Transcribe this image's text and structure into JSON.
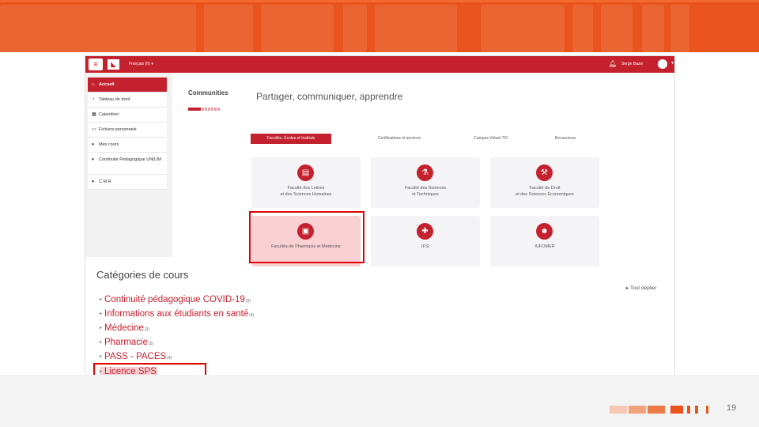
{
  "slide": {
    "page_number": "19",
    "theme_color": "#e8541b"
  },
  "app": {
    "menu_icon": "hamburger-icon",
    "logo_icon": "university-logo",
    "language": "Français (fr) ▾",
    "user_name": "Serge Bazin",
    "accent_color": "#c4212e"
  },
  "sidebar": {
    "items": [
      {
        "label": "Accueil",
        "icon": "home-icon"
      },
      {
        "label": "Tableau de bord",
        "icon": "dashboard-icon"
      },
      {
        "label": "Calendrier",
        "icon": "calendar-icon"
      },
      {
        "label": "Fichiers personnels",
        "icon": "file-icon"
      },
      {
        "label": "Mes cours",
        "icon": "graduation-cap-icon"
      },
      {
        "label": "Continuité Pédagogique UNILIM",
        "icon": "graduation-cap-icon"
      },
      {
        "label": "C.M.R",
        "icon": "graduation-cap-icon"
      }
    ]
  },
  "main": {
    "communities_label": "Communities",
    "title": "Partager, communiquer, apprendre",
    "tabs": [
      {
        "label": "Facultés, Écoles et Instituts"
      },
      {
        "label": "Certifications et services"
      },
      {
        "label": "Campus Virtuel TIC"
      },
      {
        "label": "Ressources"
      }
    ],
    "cards": [
      {
        "line1": "Faculté des Lettres",
        "line2": "et des Sciences Humaines",
        "icon": "book-icon"
      },
      {
        "line1": "Faculté des Sciences",
        "line2": "et Techniques",
        "icon": "flask-icon"
      },
      {
        "line1": "Faculté de Droit",
        "line2": "et des Sciences Économiques",
        "icon": "gavel-icon"
      },
      {
        "line1": "Facultés de Pharmacie et Médecine",
        "line2": "",
        "icon": "hospital-icon"
      },
      {
        "line1": "IFSI",
        "line2": "",
        "icon": "medical-kit-icon"
      },
      {
        "line1": "IUFOMER",
        "line2": "",
        "icon": "users-icon"
      }
    ]
  },
  "categories": {
    "title": "Catégories de cours",
    "view_all": "▸ Tout déplier",
    "items": [
      {
        "label": "Continuité pédagogique COVID-19",
        "count": "(3)"
      },
      {
        "label": "Informations aux étudiants en santé",
        "count": "(4)"
      },
      {
        "label": "Médecine",
        "count": "(3)"
      },
      {
        "label": "Pharmacie",
        "count": "(5)"
      },
      {
        "label": "PASS - PACES",
        "count": "(4)"
      },
      {
        "label": "Licence SPS",
        "count": ""
      }
    ]
  }
}
